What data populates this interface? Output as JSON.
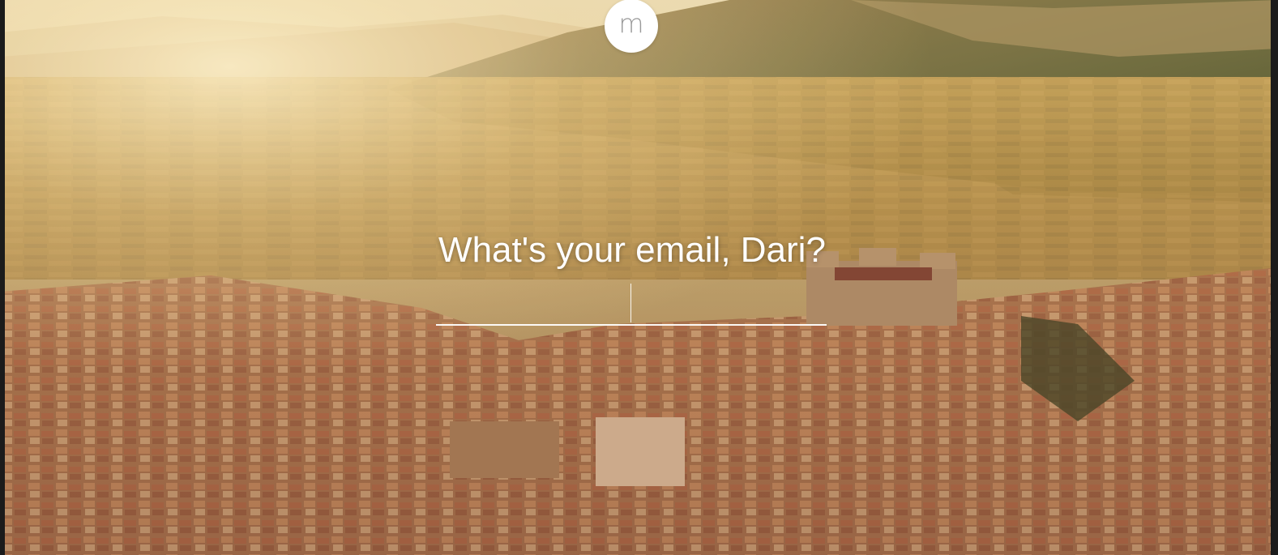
{
  "logo": {
    "letter": "m"
  },
  "prompt": {
    "text": "What's your email, Dari?"
  },
  "email": {
    "value": "",
    "placeholder": ""
  },
  "background": {
    "subject": "aerial-view-hill-town-castle-mountains-sunset"
  },
  "colors": {
    "text": "#ffffff",
    "logo_bg": "#ffffff",
    "logo_fg": "#9a9a9a"
  }
}
